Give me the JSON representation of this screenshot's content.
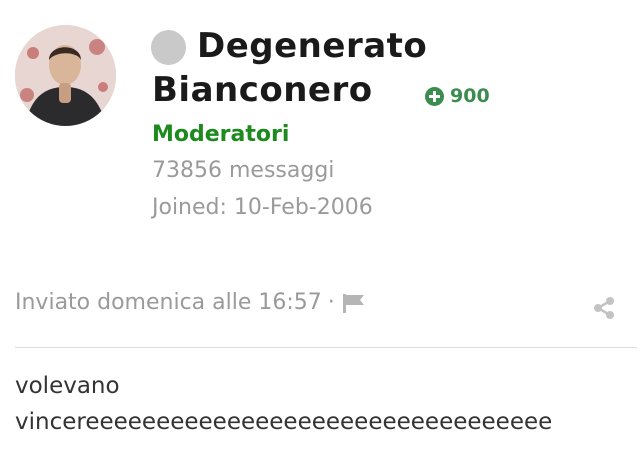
{
  "user": {
    "name_line1": "Degenerato",
    "name_line2": "Bianconero",
    "reputation": "900",
    "group": "Moderatori",
    "posts": "73856 messaggi",
    "joined": "Joined: 10-Feb-2006"
  },
  "post": {
    "meta": "Inviato domenica alle 16:57",
    "separator": "·",
    "body_line1": "volevano",
    "body_line2": "vincereeeeeeeeeeeeeeeeeeeeeeeeeeeeeeeee"
  },
  "icons": {
    "status": "offline-status-dot",
    "reputation": "plus-circle-icon",
    "report": "flag-icon",
    "share": "share-icon"
  },
  "colors": {
    "group": "#1d8a1d",
    "reputation": "#3d8c4f",
    "muted": "#9a9a9a",
    "status": "#c9c9c9"
  }
}
